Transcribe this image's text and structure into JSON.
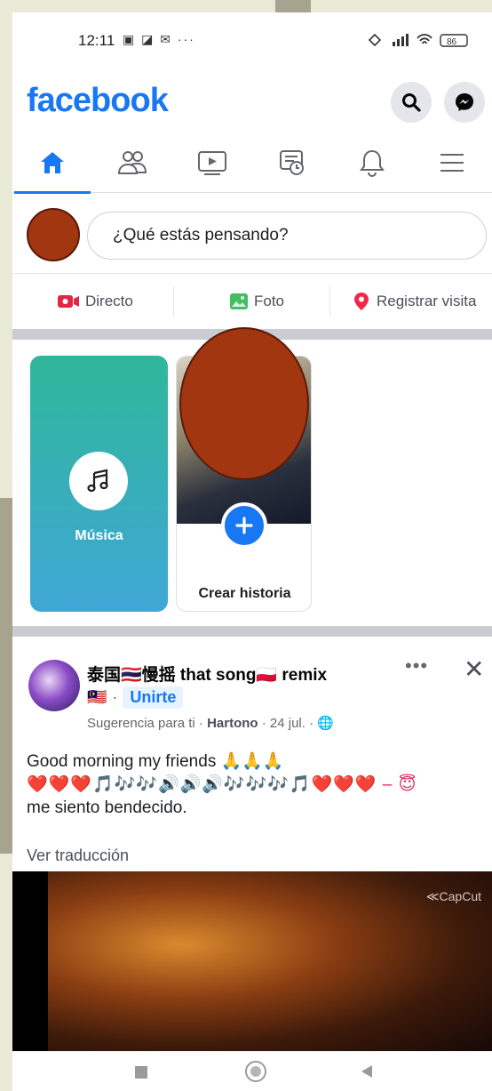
{
  "status_bar": {
    "time": "12:11",
    "notification_icons": "▣ ◪ ✉ ···",
    "system_icons": "📳 .ıl 📶 86"
  },
  "header": {
    "logo": "facebook",
    "search_icon": "search-icon",
    "messenger_icon": "messenger-icon"
  },
  "nav": {
    "tabs": [
      "home-icon",
      "friends-icon",
      "watch-icon",
      "news-icon",
      "bell-icon",
      "menu-icon"
    ],
    "active_index": 0
  },
  "composer": {
    "placeholder": "¿Qué estás pensando?"
  },
  "actions": {
    "live": "Directo",
    "photo": "Foto",
    "checkin": "Registrar visita"
  },
  "stories": {
    "music_label": "Música",
    "create_label": "Crear historia"
  },
  "post": {
    "title": "泰国🇹🇭慢摇 that song🇵🇱 remix",
    "flag": "🇲🇾",
    "join_label": "Unirte",
    "meta_prefix": "Sugerencia para ti · ",
    "meta_author": "Hartono",
    "meta_suffix": " · 24 jul. · 🌐",
    "text_line1": "Good morning my friends 🙏🙏🙏",
    "text_line2": "❤️❤️❤️🎵🎶🎶🔊🔊🔊🎶🎶🎶🎵❤️❤️❤️ – 😇",
    "text_line3": "me siento bendecido.",
    "see_translation": "Ver traducción",
    "video_watermark": "≪CapCut"
  },
  "colors": {
    "brand": "#1877f2",
    "censor": "#a13611"
  }
}
